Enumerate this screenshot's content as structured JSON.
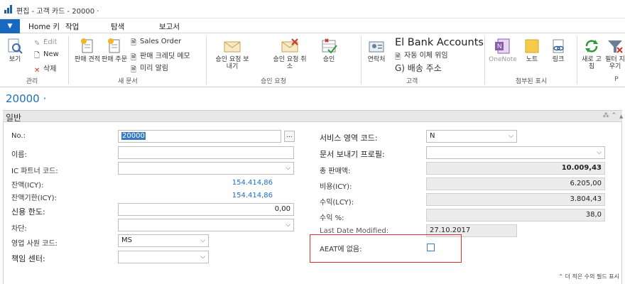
{
  "window": {
    "title": "편집 - 고객 카드 - 20000 ·"
  },
  "ribbon_tabs": [
    "Home 키",
    "작업",
    "탐색",
    "보고서"
  ],
  "ribbon": {
    "manage": {
      "view": "보기",
      "edit": "Edit",
      "new": "New",
      "delete": "삭제",
      "group": "관리"
    },
    "new_doc": {
      "quote": "판매 견적",
      "order": "판매 주문",
      "sales_order": "Sales Order",
      "credit_memo_template": "판매 크레딧 메모",
      "reminder": "미리 알림",
      "group": "새 문서"
    },
    "approval": {
      "send": "승인 요청 보내기",
      "cancel": "승인 요청 취소",
      "approve": "승인",
      "group": "승인 요청"
    },
    "customer": {
      "contact": "연락처",
      "bank_accounts": "El Bank Accounts",
      "direct_debit": "자동 이체 위임",
      "ship_to": "G) 배송 주소",
      "group": "고객"
    },
    "attachments": {
      "onenote": "OneNote",
      "notes": "노트",
      "links": "링크",
      "group": "첨부된 표시"
    },
    "page": {
      "refresh": "새로 고침",
      "filter": "필터 지우기",
      "group": "P"
    }
  },
  "record": {
    "number": "20000 ·"
  },
  "fasttab": {
    "title": "일반",
    "footer": "더 적은 수의 필드 표시"
  },
  "left_fields": {
    "no": {
      "label": "No.:",
      "value": "20000",
      "ellipsis": "..."
    },
    "name": {
      "label": "이름:",
      "value": ""
    },
    "ic_partner": {
      "label": "IC 파트너 코드:",
      "value": ""
    },
    "balance_lcy": {
      "label": "잔액(ICY):",
      "value": "154.414,86"
    },
    "balance_due_lcy": {
      "label": "잔액기한(ICY):",
      "value": "154.414,86"
    },
    "credit_limit": {
      "label": "신용 한도:",
      "value": "0,00"
    },
    "blocked": {
      "label": "차단:",
      "value": ""
    },
    "salesperson": {
      "label": "영업 사원 코드:",
      "value": "MS"
    },
    "responsibility_center": {
      "label": "책임 센터:",
      "value": ""
    }
  },
  "right_fields": {
    "service_zone": {
      "label": "서비스 영역 코드:",
      "value": "N"
    },
    "doc_sending_profile": {
      "label": "문서 보내기 프로필:",
      "value": ""
    },
    "total_sales": {
      "label": "총 판매액:",
      "value": "10.009,43"
    },
    "costs_lcy": {
      "label": "비용(ICY):",
      "value": "6.205,00"
    },
    "profit_lcy": {
      "label": "수익(LCY):",
      "value": "3.804,43"
    },
    "profit_pct": {
      "label": "수익 %:",
      "value": "38,0"
    },
    "last_modified": {
      "label": "Last Date Modified:",
      "value": "27.10.2017"
    },
    "aeat": {
      "label": "AEAT에 없음:",
      "checked": false
    }
  },
  "colors": {
    "accent": "#1769bf",
    "highlight_box": "#d9342b"
  }
}
